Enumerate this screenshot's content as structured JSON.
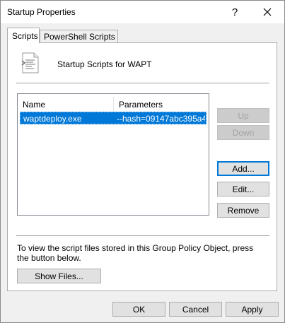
{
  "window": {
    "title": "Startup Properties"
  },
  "titlebar": {
    "help_label": "?"
  },
  "tabs": [
    {
      "label": "Scripts"
    },
    {
      "label": "PowerShell Scripts"
    }
  ],
  "header": {
    "text": "Startup Scripts for WAPT"
  },
  "table": {
    "columns": [
      "Name",
      "Parameters"
    ],
    "rows": [
      {
        "name": "waptdeploy.exe",
        "parameters": "--hash=09147abc395a4..."
      }
    ]
  },
  "side_buttons": {
    "up": "Up",
    "down": "Down",
    "add": "Add...",
    "edit": "Edit...",
    "remove": "Remove"
  },
  "info": {
    "text": "To view the script files stored in this Group Policy Object, press the button below.",
    "show_files": "Show Files..."
  },
  "footer": {
    "ok": "OK",
    "cancel": "Cancel",
    "apply": "Apply"
  }
}
